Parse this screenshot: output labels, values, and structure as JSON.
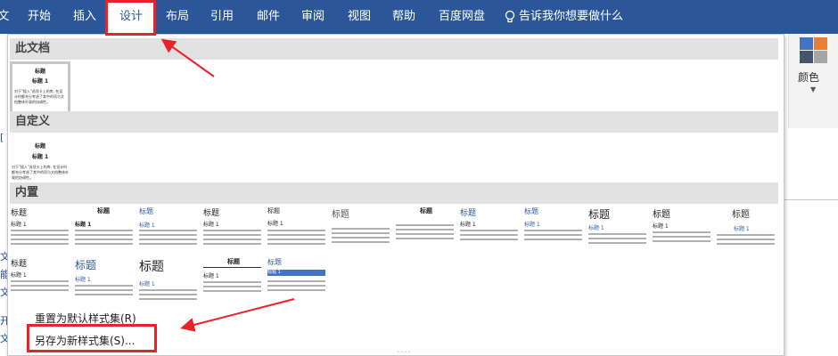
{
  "ribbon": {
    "tabs": [
      "文件",
      "开始",
      "插入",
      "设计",
      "布局",
      "引用",
      "邮件",
      "审阅",
      "视图",
      "帮助",
      "百度网盘"
    ],
    "active_tab": "设计",
    "tell_me": "告诉我你想要做什么",
    "colors_label": "颜色"
  },
  "gallery": {
    "sections": {
      "this_document": "此文档",
      "custom": "自定义",
      "builtin": "内置"
    },
    "thumb_title": "标题",
    "thumb_heading": "标题 1",
    "thumb_body": "对于\"插入\"选项卡上的库, 在设计时都充分考虑了其中的项与文档整体外观的协调性。"
  },
  "menu": {
    "reset": "重置为默认样式集(R)",
    "save_as": "另存为新样式集(S)..."
  },
  "accent": {
    "ribbon_blue": "#2b579a",
    "annotation_red": "#e8232a"
  }
}
